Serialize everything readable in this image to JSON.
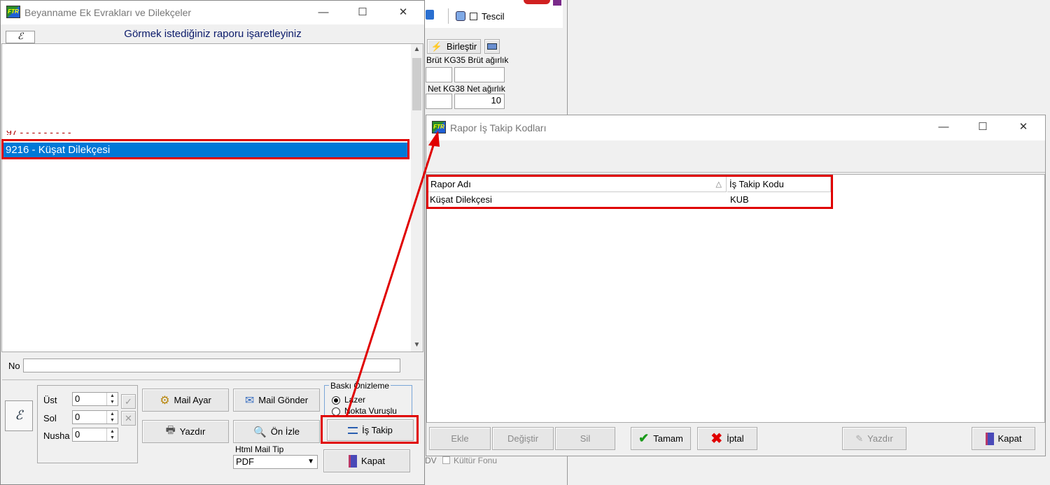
{
  "left_window": {
    "title": "Beyanname Ek Evrakları ve Dilekçeler",
    "heading": "Görmek istediğiniz raporu işaretleyiniz",
    "selected_item": "9216 - Küşat Dilekçesi",
    "no_label": "No",
    "no_value": "",
    "ust_label": "Üst",
    "ust_value": "0",
    "sol_label": "Sol",
    "sol_value": "0",
    "nusha_label": "Nusha",
    "nusha_value": "0",
    "buttons": {
      "mail_ayar": "Mail Ayar",
      "mail_gonder": "Mail Gönder",
      "yazdir": "Yazdır",
      "on_izle": "Ön İzle",
      "is_takip": "İş Takip",
      "kapat": "Kapat"
    },
    "baski_onizleme": "Baskı Önizleme",
    "radio_lazer": "Lazer",
    "radio_nokta": "Nokta Vuruşlu",
    "html_mail_tip_label": "Html Mail Tip",
    "html_mail_tip_value": "PDF"
  },
  "background": {
    "tescil_label": "Tescil",
    "birlestir_label": "Birleştir",
    "brut_label": "Brüt KG35 Brüt ağırlık",
    "net_label": "Net KG38 Net ağırlık",
    "net_value": "10",
    "dv_label": "DV",
    "kultur_fonu_label": "Kültür Fonu"
  },
  "right_window": {
    "title": "Rapor İş Takip Kodları",
    "columns": [
      "Rapor Adı",
      "İş Takip Kodu"
    ],
    "rows": [
      [
        "Küşat Dilekçesi",
        "KUB"
      ]
    ],
    "buttons": {
      "ekle": "Ekle",
      "degistir": "Değiştir",
      "sil": "Sil",
      "tamam": "Tamam",
      "iptal": "İptal",
      "yazdir": "Yazdır",
      "kapat": "Kapat"
    }
  },
  "colors": {
    "accent_red": "#e00000",
    "selection_blue": "#0078d7"
  }
}
